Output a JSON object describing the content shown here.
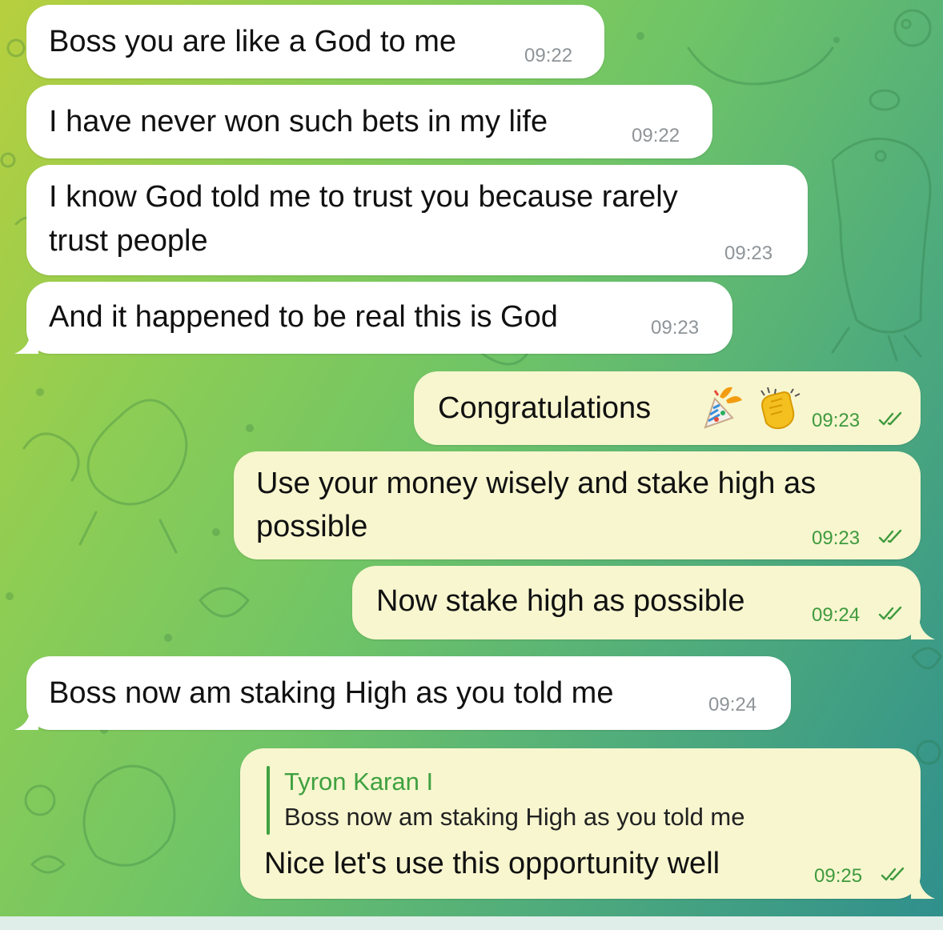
{
  "messages": [
    {
      "id": 1,
      "direction": "incoming",
      "text": "Boss you are like a God to me",
      "time": "09:22"
    },
    {
      "id": 2,
      "direction": "incoming",
      "text": "I have never won such bets in my life",
      "time": "09:22"
    },
    {
      "id": 3,
      "direction": "incoming",
      "lines": [
        "I know God told me to trust you because  rarely",
        "trust people"
      ],
      "time": "09:23"
    },
    {
      "id": 4,
      "direction": "incoming",
      "text": "And it happened to be real this is God",
      "time": "09:23"
    },
    {
      "id": 5,
      "direction": "outgoing",
      "text": "Congratulations",
      "emojis": [
        "party-popper-icon",
        "clapping-hands-icon"
      ],
      "time": "09:23",
      "status": "read"
    },
    {
      "id": 6,
      "direction": "outgoing",
      "lines": [
        "Use your money wisely and stake high as",
        "possible"
      ],
      "time": "09:23",
      "status": "read"
    },
    {
      "id": 7,
      "direction": "outgoing",
      "text": "Now stake high as possible",
      "time": "09:24",
      "status": "read"
    },
    {
      "id": 8,
      "direction": "incoming",
      "text": "Boss now am staking High as you told me",
      "time": "09:24"
    },
    {
      "id": 9,
      "direction": "outgoing",
      "reply_to": {
        "name": "Tyron Karan I",
        "text": "Boss now am staking High as you told me"
      },
      "text": "Nice let's use this opportunity well",
      "time": "09:25",
      "status": "read"
    }
  ],
  "colors": {
    "incoming_bubble": "#ffffff",
    "outgoing_bubble": "#f7f6cf",
    "outgoing_meta": "#3f9a3e",
    "reply_accent": "#3fa140",
    "background_start": "#b7cf3e",
    "background_end": "#2f8f8d"
  }
}
